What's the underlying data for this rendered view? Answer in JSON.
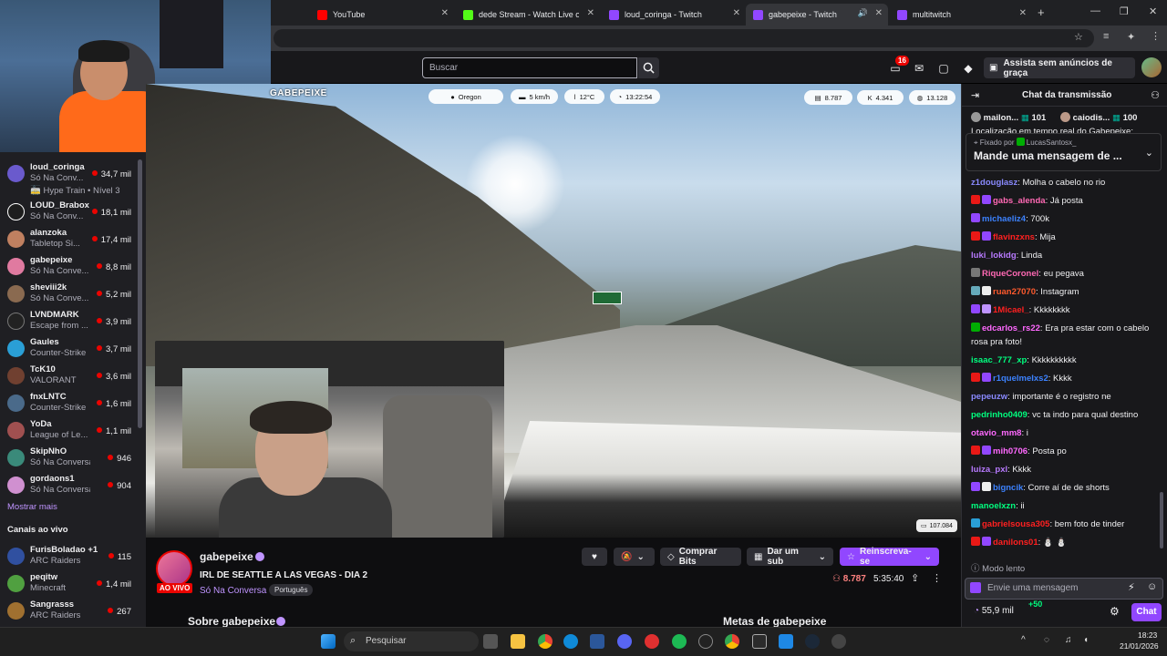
{
  "tabs": [
    {
      "label": "YouTube",
      "color": "#ff0000"
    },
    {
      "label": "dede Stream - Watch Live on K",
      "color": "#53fc18"
    },
    {
      "label": "loud_coringa - Twitch",
      "color": "#9147ff"
    },
    {
      "label": "gabepeixe - Twitch",
      "color": "#9147ff"
    },
    {
      "label": "multitwitch",
      "color": "#9147ff"
    }
  ],
  "topnav": {
    "search_placeholder": "Buscar",
    "notification_count": "16",
    "prime_label": "Assista sem anúncios de graça"
  },
  "sidebar": {
    "channels": [
      {
        "name": "loud_coringa",
        "game": "Só Na Conv...",
        "viewers": "34,7 mil",
        "extra": "Hype Train • Nível 3"
      },
      {
        "name": "LOUD_Brabox",
        "game": "Só Na Conv...",
        "viewers": "18,1 mil"
      },
      {
        "name": "alanzoka",
        "game": "Tabletop Si...",
        "viewers": "17,4 mil"
      },
      {
        "name": "gabepeixe",
        "game": "Só Na Conve...",
        "viewers": "8,8 mil"
      },
      {
        "name": "sheviii2k",
        "game": "Só Na Conve...",
        "viewers": "5,2 mil"
      },
      {
        "name": "LVNDMARK",
        "game": "Escape from ...",
        "viewers": "3,9 mil"
      },
      {
        "name": "Gaules",
        "game": "Counter-Strike",
        "viewers": "3,7 mil"
      },
      {
        "name": "TcK10",
        "game": "VALORANT",
        "viewers": "3,6 mil"
      },
      {
        "name": "fnxLNTC",
        "game": "Counter-Strike",
        "viewers": "1,6 mil"
      },
      {
        "name": "YoDa",
        "game": "League of Le...",
        "viewers": "1,1 mil"
      },
      {
        "name": "SkipNhO",
        "game": "Só Na Conversa",
        "viewers": "946"
      },
      {
        "name": "gordaons1",
        "game": "Só Na Conversa",
        "viewers": "904"
      }
    ],
    "show_more": "Mostrar mais",
    "live_header": "Canais ao vivo",
    "live_channels": [
      {
        "name": "FurisBoladao +1",
        "game": "ARC Raiders",
        "viewers": "115"
      },
      {
        "name": "peqitw",
        "game": "Minecraft",
        "viewers": "1,4 mil"
      },
      {
        "name": "Sangrasss",
        "game": "ARC Raiders",
        "viewers": "267"
      }
    ]
  },
  "video": {
    "logo": "GABEPEIXE",
    "location": "Oregon",
    "speed": "5 km/h",
    "temp": "12°C",
    "time": "13:22:54",
    "stat1": "8.787",
    "stat2": "4.341",
    "stat3": "13.128",
    "points": "107.084"
  },
  "stream": {
    "streamer": "gabepeixe",
    "title": "IRL DE SEATTLE A LAS VEGAS - DIA 2",
    "category": "Só Na Conversa",
    "tag": "Português",
    "live_badge": "AO VIVO",
    "viewers": "8.787",
    "uptime": "5:35:40",
    "buy_bits": "Comprar Bits",
    "gift_sub": "Dar um sub",
    "resub": "Reinscreva-se",
    "about": "Sobre gabepeixe",
    "goals": "Metas de gabepeixe"
  },
  "chat": {
    "header": "Chat da transmissão",
    "top1_name": "mailon...",
    "top1_count": "101",
    "top2_name": "caiodis...",
    "top2_count": "100",
    "cut_line": "Localização em tempo real do Gabepeixe:",
    "pinned_by": "Fixado por",
    "pinned_user": "LucasSantosx_",
    "pinned_text": "Mande uma mensagem de ...",
    "messages": [
      {
        "user": "z1douglasz",
        "color": "#8a8aff",
        "text": "Molha o cabelo no rio"
      },
      {
        "user": "gabs_alenda",
        "color": "#ff69b4",
        "text": "Já posta"
      },
      {
        "user": "michaeliz4",
        "color": "#3c82ff",
        "text": "700k"
      },
      {
        "user": "flavinzxns",
        "color": "#ff2020",
        "text": "Mija"
      },
      {
        "user": "luki_lokidg",
        "color": "#b87aff",
        "text": "Linda"
      },
      {
        "user": "RiqueCoronel",
        "color": "#ff69b4",
        "text": "eu pegava"
      },
      {
        "user": "ruan27070",
        "color": "#ff5a2d",
        "text": "Instagram"
      },
      {
        "user": "1Micael_",
        "color": "#ff2020",
        "text": "Kkkkkkkk"
      },
      {
        "user": "edcarlos_rs22",
        "color": "#ff69ff",
        "text": "Era pra estar com o cabelo rosa pra foto!"
      },
      {
        "user": "isaac_777_xp",
        "color": "#00ff7f",
        "text": "Kkkkkkkkkk"
      },
      {
        "user": "r1quelmeIxs2",
        "color": "#3c82ff",
        "text": "Kkkk"
      },
      {
        "user": "pepeuzw",
        "color": "#8a8aff",
        "text": "importante é o registro ne"
      },
      {
        "user": "pedrinho0409",
        "color": "#00ff7f",
        "text": "vc ta indo para qual destino"
      },
      {
        "user": "otavio_mm8",
        "color": "#ff69ff",
        "text": "i"
      },
      {
        "user": "mih0706",
        "color": "#ff69ff",
        "text": "Posta po"
      },
      {
        "user": "luiza_pxl",
        "color": "#b87aff",
        "text": "Kkkk"
      },
      {
        "user": "bigncik",
        "color": "#3c82ff",
        "text": "Corre aí de de shorts"
      },
      {
        "user": "manoelxzn",
        "color": "#00ff7f",
        "text": "ii"
      },
      {
        "user": "gabrielsousa305",
        "color": "#ff2020",
        "text": "bem foto de tinder"
      },
      {
        "user": "danilons01",
        "color": "#ff2020",
        "text": ""
      }
    ],
    "slow_mode": "Modo lento",
    "input_placeholder": "Envie uma mensagem",
    "points": "55,9 mil",
    "points_bonus": "+50",
    "send_label": "Chat"
  },
  "taskbar": {
    "search_placeholder": "Pesquisar",
    "time": "18:23",
    "date": "21/01/2026"
  },
  "colors": {
    "accent": "#9147ff",
    "live": "#eb0400"
  }
}
